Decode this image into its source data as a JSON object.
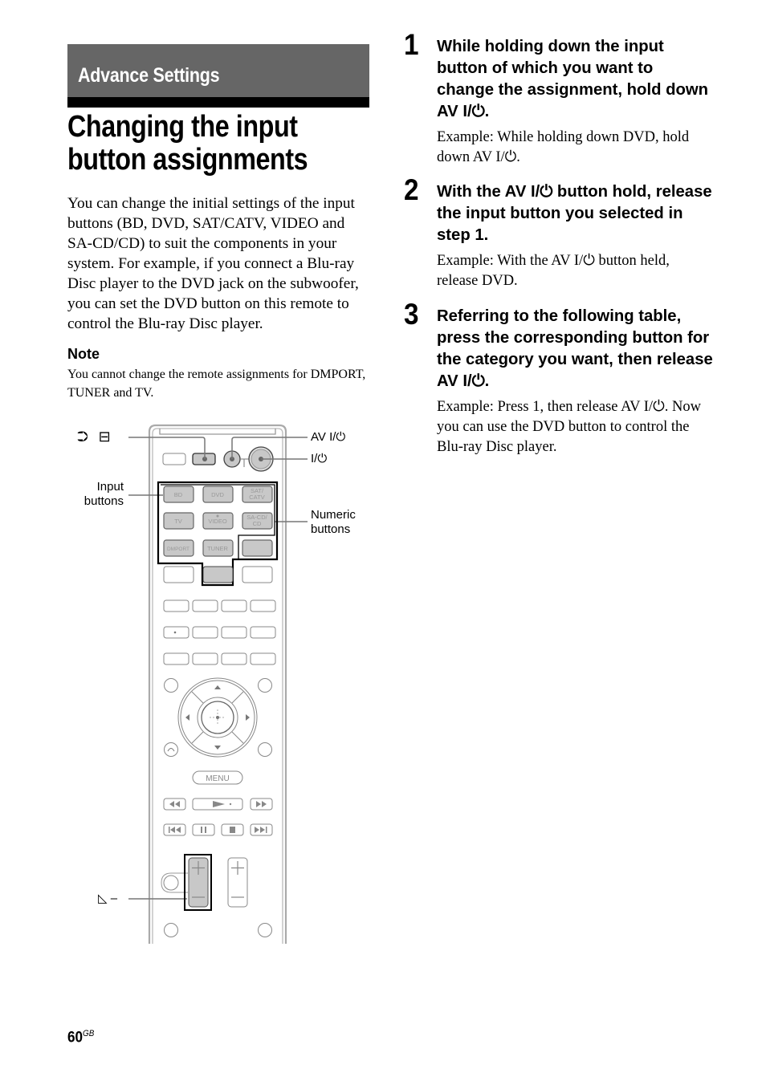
{
  "section": {
    "title": "Advance Settings"
  },
  "page_title": "Changing the input button assignments",
  "intro": "You can change the initial settings of the input buttons (BD, DVD, SAT/CATV, VIDEO and SA-CD/CD) to suit the components in your system. For example, if you connect a Blu-ray Disc player to the DVD jack on the subwoofer, you can set the DVD button on this remote to control the Blu-ray Disc player.",
  "note": {
    "heading": "Note",
    "text": "You cannot change the remote assignments for DMPORT, TUNER and TV."
  },
  "power_symbol": "I/⏻",
  "steps": [
    {
      "number": "1",
      "heading_pre": "While holding down the input button of which you want to change the assignment, hold down AV ",
      "heading_post": ".",
      "example_pre": "Example: While holding down DVD, hold down AV ",
      "example_post": "."
    },
    {
      "number": "2",
      "heading_pre": "With the AV ",
      "heading_post": " button hold, release the input button you selected in step 1.",
      "example_pre": "Example: With the AV ",
      "example_post": " button held, release DVD."
    },
    {
      "number": "3",
      "heading_pre": "Referring to the following table, press the corresponding button for the category you want, then release AV ",
      "heading_post": ".",
      "example_pre": "Example: Press 1, then release AV ",
      "example_post": ". Now you can use the DVD button to control the Blu-ray Disc player."
    }
  ],
  "diagram": {
    "callouts": {
      "input_icons": "⮊ ⊟",
      "av_power": "AV I/⏻",
      "power": "I/⏻",
      "input_buttons_line1": "Input",
      "input_buttons_line2": "buttons",
      "numeric_buttons_line1": "Numeric",
      "numeric_buttons_line2": "buttons",
      "volume_minus": "◺ –"
    },
    "input_buttons": [
      "BD",
      "DVD",
      "SAT/",
      "CATV",
      "TV",
      "VIDEO",
      "SA-CD/",
      "CD",
      "DMPORT",
      "TUNER"
    ],
    "menu_label": "MENU"
  },
  "page_number": "60",
  "page_suffix": "GB"
}
